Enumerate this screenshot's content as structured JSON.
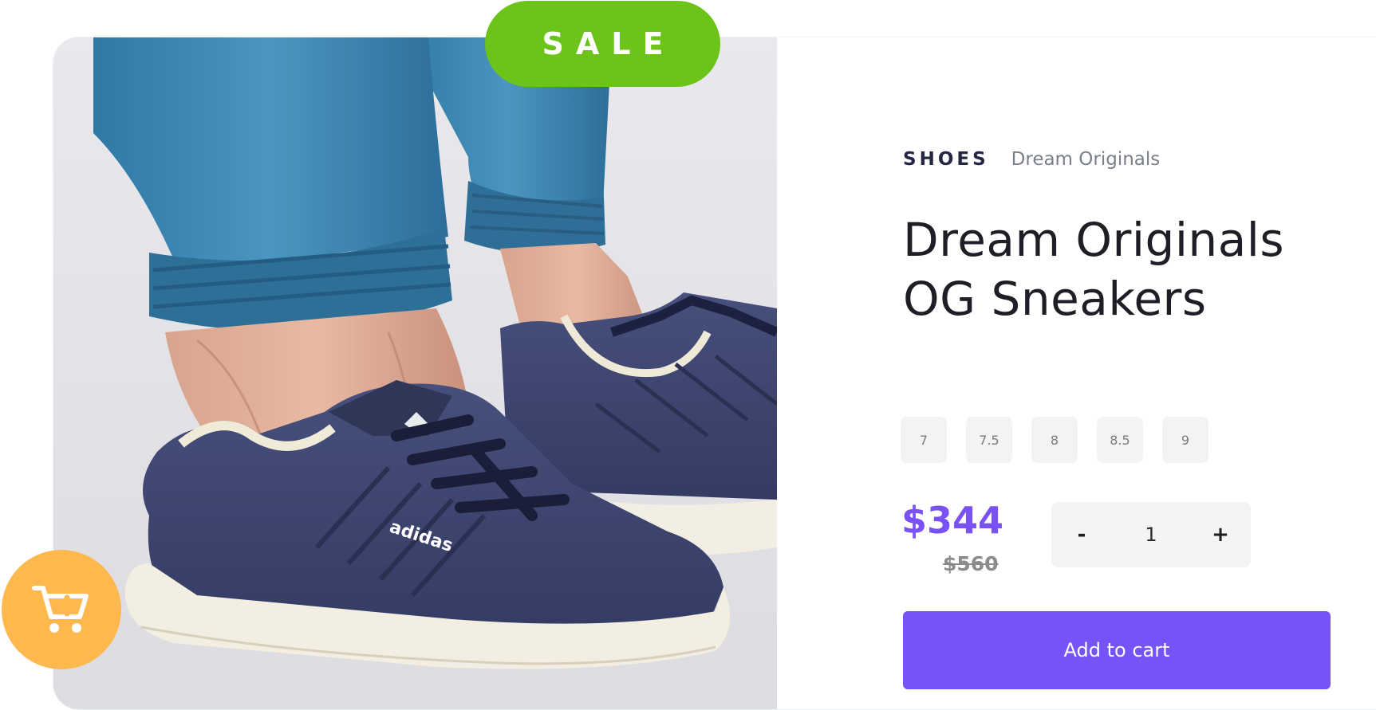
{
  "badge": {
    "label": "SALE"
  },
  "product": {
    "category": "SHOES",
    "brand": "Dream Originals",
    "title_line1": "Dream Originals",
    "title_line2": "OG Sneakers",
    "image_icon": "sneaker-photo",
    "sizes": [
      "7",
      "7.5",
      "8",
      "8.5",
      "9"
    ],
    "price": "$344",
    "old_price": "$560"
  },
  "quantity": {
    "decrement_label": "-",
    "value": "1",
    "increment_label": "+"
  },
  "actions": {
    "add_to_cart_label": "Add to cart",
    "fab_icon": "cart-plus-icon"
  },
  "colors": {
    "sale_green": "#6cc31a",
    "accent_purple": "#7553f6",
    "fab_orange": "#ffb84d",
    "denim_blue": "#3f88b3",
    "sneaker_navy": "#3f4670"
  }
}
